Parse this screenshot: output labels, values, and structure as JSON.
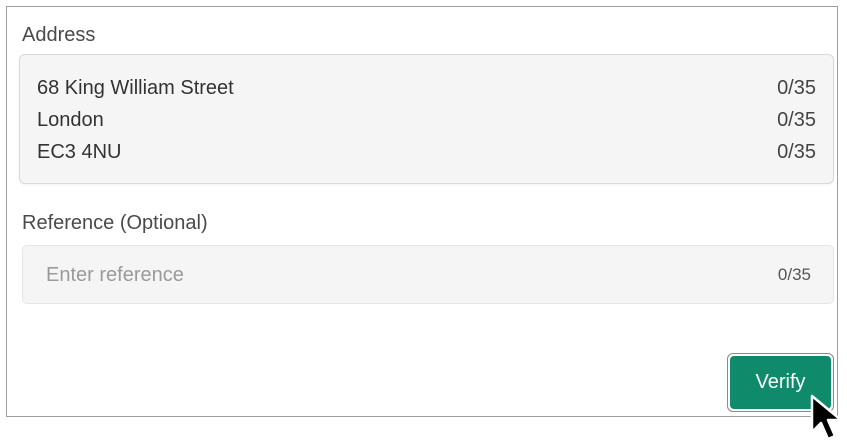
{
  "address": {
    "label": "Address",
    "lines": [
      {
        "value": "68 King William Street",
        "counter": "0/35"
      },
      {
        "value": "London",
        "counter": "0/35"
      },
      {
        "value": "EC3 4NU",
        "counter": "0/35"
      }
    ]
  },
  "reference": {
    "label": "Reference (Optional)",
    "placeholder": "Enter reference",
    "counter": "0/35"
  },
  "actions": {
    "verify_label": "Verify",
    "verify_color": "#0f8a6b"
  },
  "cursor": {
    "icon": "mouse-pointer-icon"
  }
}
